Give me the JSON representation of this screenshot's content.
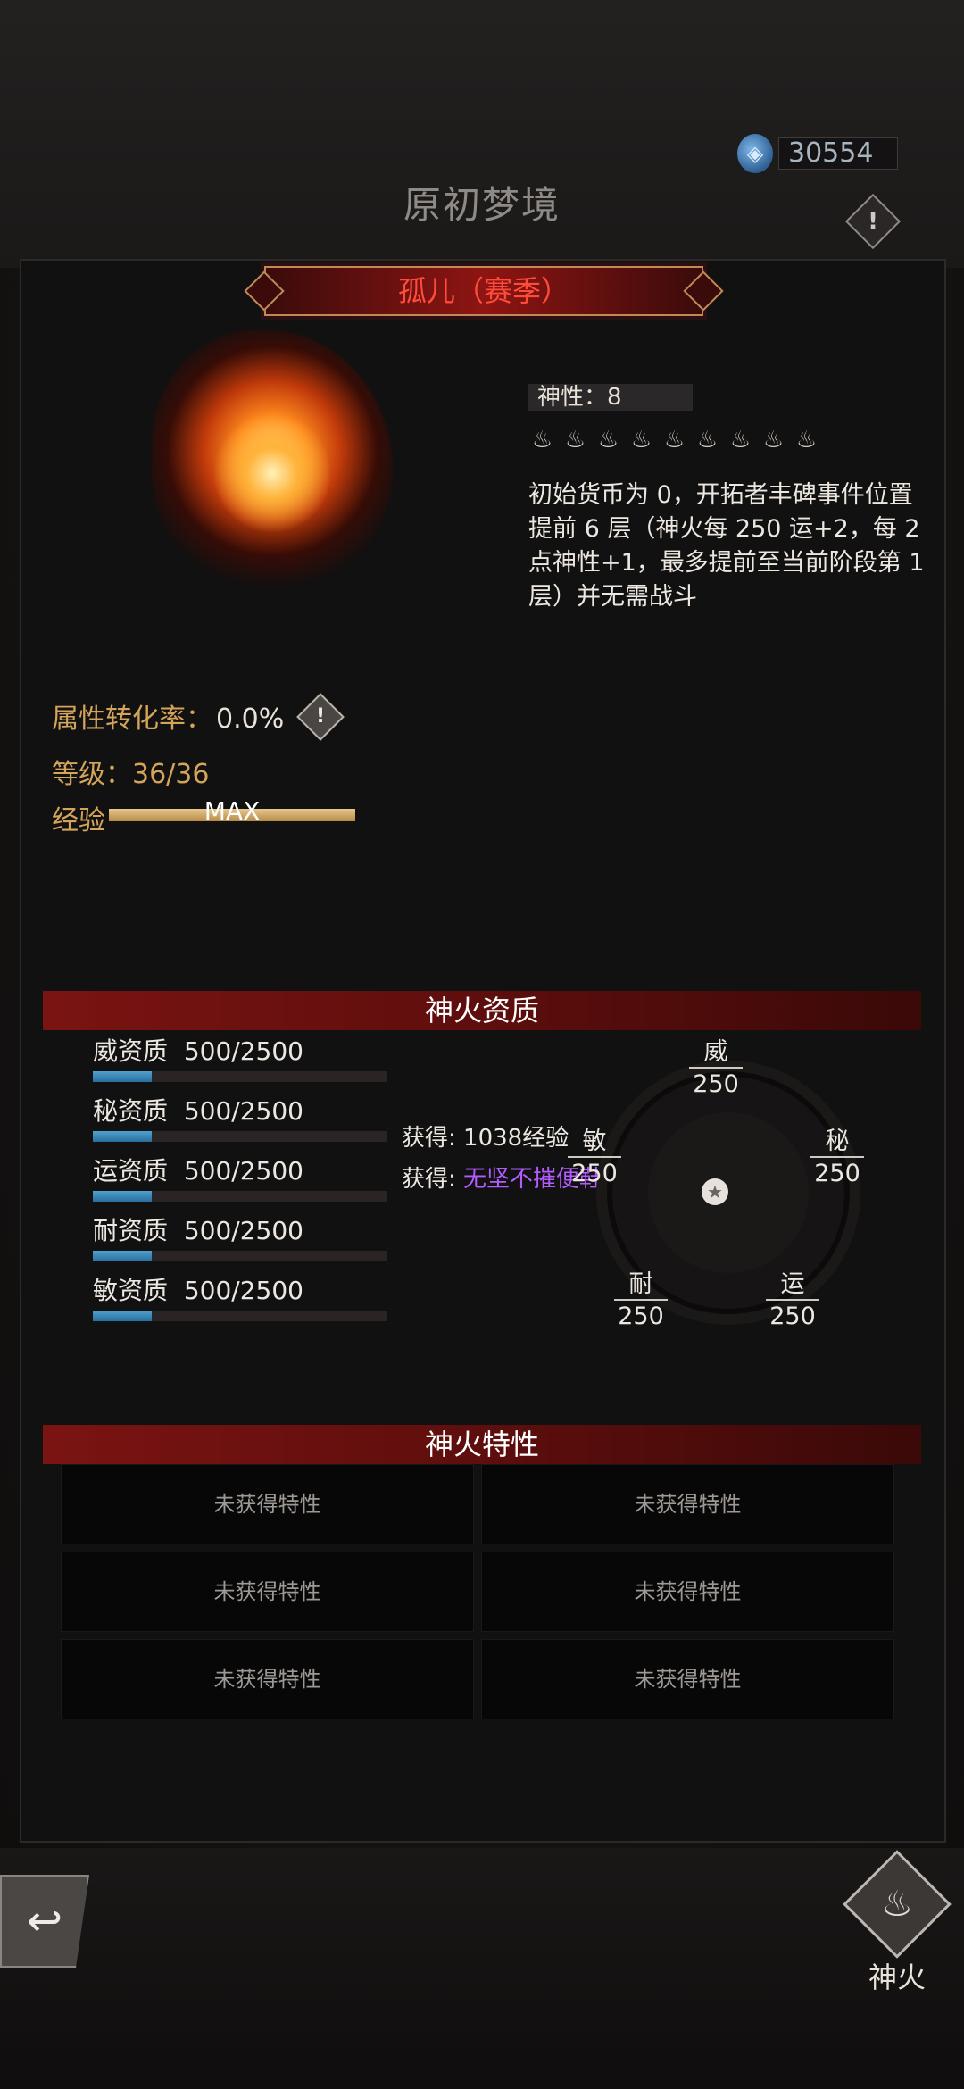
{
  "header": {
    "title": "原初梦境",
    "currency_value": "30554",
    "season_banner": "孤儿（赛季）"
  },
  "profile": {
    "divinity_label": "神性：8",
    "divinity_icons": [
      "flame-icon",
      "flame-icon",
      "flame-icon",
      "flame-icon",
      "flame-icon",
      "flame-icon",
      "flame-icon",
      "flame-icon",
      "flame-icon"
    ],
    "description": "初始货币为 0，开拓者丰碑事件位置提前 6 层（神火每 250 运+2，每 2 点神性+1，最多提前至当前阶段第 1 层）并无需战斗",
    "attr_rate_label": "属性转化率：",
    "attr_rate_value": "0.0%",
    "level_label": "等级：36/36",
    "exp_label": "经验",
    "exp_value": "MAX",
    "exp_progress": 1.0
  },
  "qualities": {
    "section_title": "神火资质",
    "items": [
      {
        "name": "威资质",
        "value": "500/2500",
        "progress": 0.2
      },
      {
        "name": "秘资质",
        "value": "500/2500",
        "progress": 0.2
      },
      {
        "name": "运资质",
        "value": "500/2500",
        "progress": 0.2
      },
      {
        "name": "耐资质",
        "value": "500/2500",
        "progress": 0.2
      },
      {
        "name": "敏资质",
        "value": "500/2500",
        "progress": 0.2
      }
    ],
    "gain_1": "获得: 1038经验",
    "gain_2_label": "获得: ",
    "gain_2_value": "无坚不摧便鞋",
    "radar": {
      "wei": {
        "label": "威",
        "value": "250"
      },
      "mi": {
        "label": "秘",
        "value": "250"
      },
      "yun": {
        "label": "运",
        "value": "250"
      },
      "nai": {
        "label": "耐",
        "value": "250"
      },
      "min": {
        "label": "敏",
        "value": "250"
      }
    }
  },
  "traits": {
    "section_title": "神火特性",
    "slots": [
      "未获得特性",
      "未获得特性",
      "未获得特性",
      "未获得特性",
      "未获得特性",
      "未获得特性"
    ]
  },
  "footer": {
    "fire_label": "神火"
  }
}
